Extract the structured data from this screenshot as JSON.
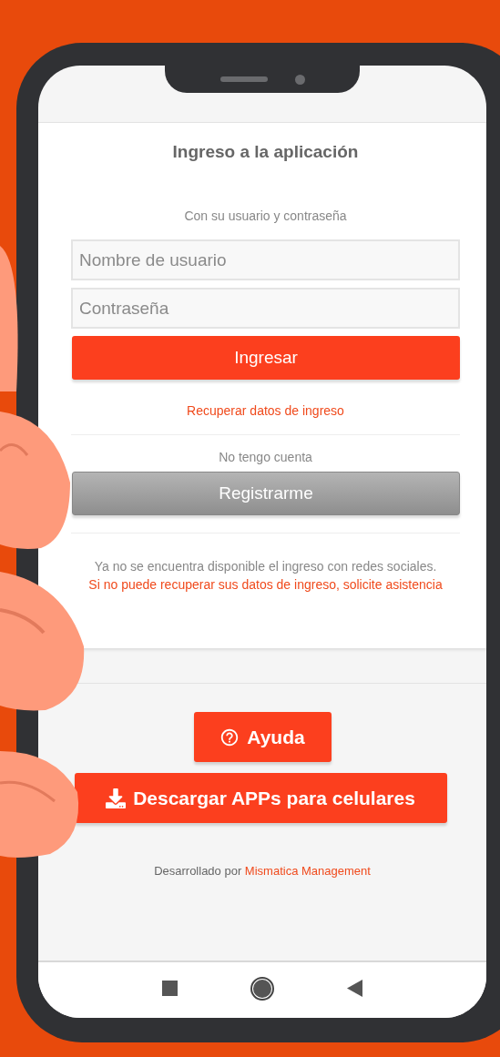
{
  "login": {
    "title": "Ingreso a la aplicación",
    "subtitle": "Con su usuario y contraseña",
    "username": {
      "placeholder": "Nombre de usuario"
    },
    "password": {
      "placeholder": "Contraseña"
    },
    "submit": "Ingresar",
    "recover_link": "Recuperar datos de ingreso",
    "no_account": "No tengo cuenta",
    "register": "Registrarme",
    "notice": "Ya no se encuentra disponible el ingreso con redes sociales.",
    "support_link": "Si no puede recuperar sus datos de ingreso, solicite asistencia"
  },
  "actions": [
    {
      "kind": "help",
      "label": "Ayuda"
    },
    {
      "kind": "download",
      "label": "Descargar APPs para celulares"
    }
  ],
  "footer": {
    "text": "Desarrollado por",
    "link": "Mismatica Management"
  }
}
